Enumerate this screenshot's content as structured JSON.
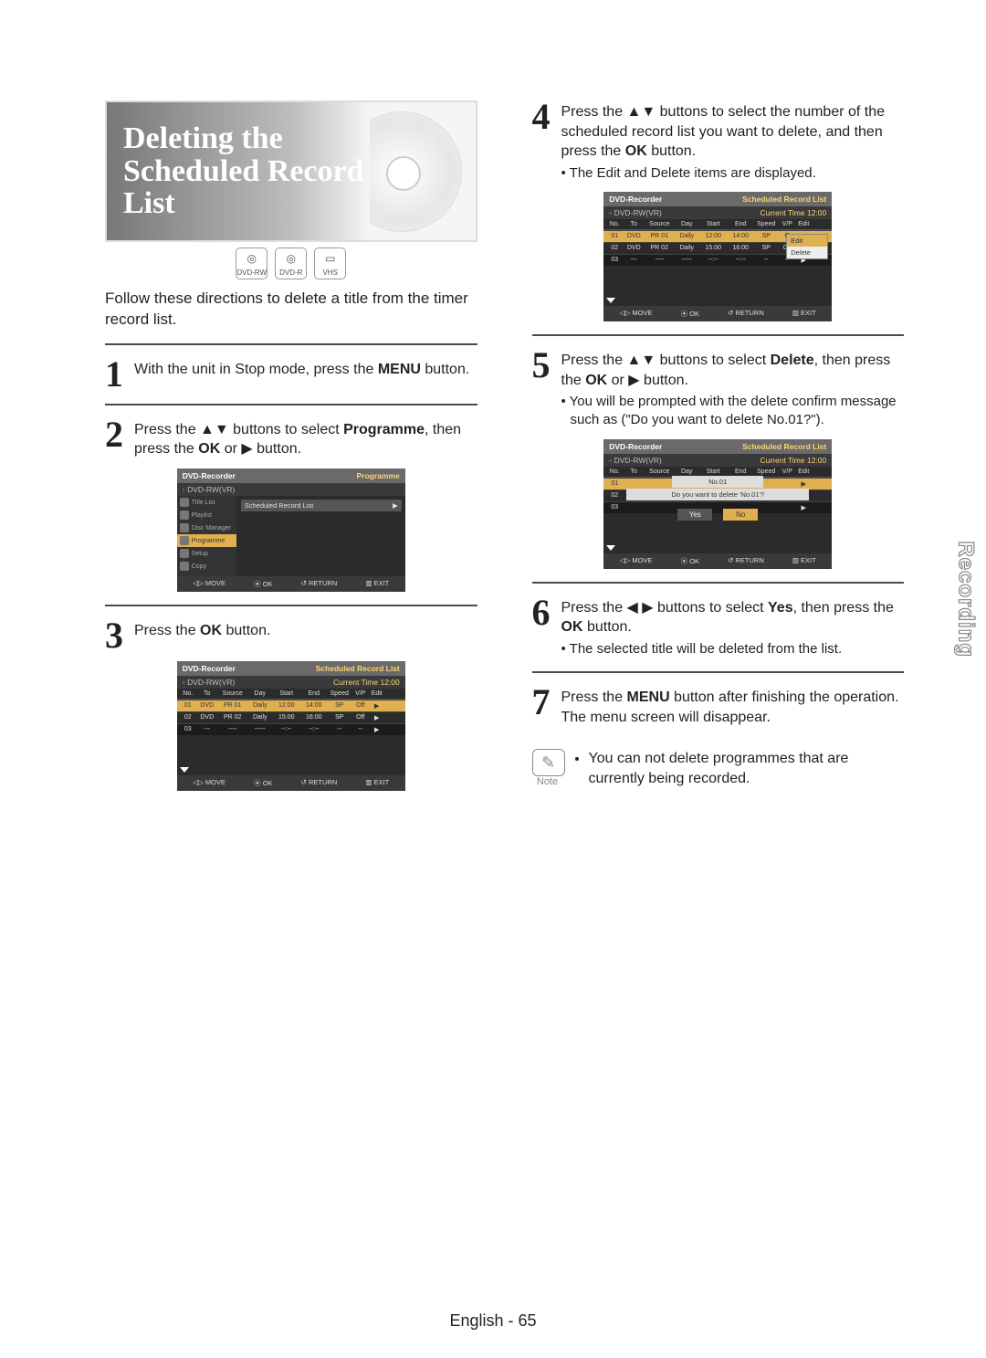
{
  "section_side_tab": "Recording",
  "footer": "English - 65",
  "hero": {
    "title_line1": "Deleting the",
    "title_line2": "Scheduled Record List"
  },
  "media": {
    "dvd_rw": "DVD-RW",
    "dvd_r": "DVD-R",
    "vhs": "VHS"
  },
  "intro": "Follow these directions to delete a title from the timer record list.",
  "step1": {
    "num": "1",
    "text_before": "With the unit in Stop mode, press the ",
    "menu": "MENU",
    "text_after": " button."
  },
  "step2": {
    "num": "2",
    "text_a": "Press the ▲▼ buttons to select ",
    "prog": "Programme",
    "text_b": ", then press the ",
    "ok": "OK",
    "text_c": " or ▶ button."
  },
  "step3": {
    "num": "3",
    "text_a": "Press the ",
    "ok": "OK",
    "text_b": " button."
  },
  "step4": {
    "num": "4",
    "text_a": "Press the ▲▼ buttons to select the number of the scheduled record list you want to delete, and then press the ",
    "ok": "OK",
    "text_b": " button.",
    "bullet": "The Edit and Delete items are displayed."
  },
  "step5": {
    "num": "5",
    "text_a": "Press the ▲▼  buttons to select ",
    "del": "Delete",
    "text_b": ", then press the ",
    "ok": "OK",
    "text_c": " or ▶ button.",
    "bullet": "You will be prompted with the delete confirm message such as (\"Do you want to delete No.01?\")."
  },
  "step6": {
    "num": "6",
    "text_a": "Press the ◀ ▶ buttons to select ",
    "yes": "Yes",
    "text_b": ", then press the ",
    "ok": "OK",
    "text_c": " button.",
    "bullet": "The selected title will be deleted from the list."
  },
  "step7": {
    "num": "7",
    "text_a": "Press the ",
    "menu": "MENU",
    "text_b": " button after finishing the operation. The menu screen will disappear."
  },
  "note": {
    "label": "Note",
    "item": "You can not delete programmes that are currently being recorded."
  },
  "osd_common": {
    "head_left": "DVD-Recorder",
    "head_right_prog": "Programme",
    "head_right_list": "Scheduled Record List",
    "disc": "DVD-RW(VR)",
    "time": "Current Time  12:00",
    "foot_move": "◁▷ MOVE",
    "foot_ok": "⦿ OK",
    "foot_return": "↺ RETURN",
    "foot_exit": "▥ EXIT"
  },
  "osd_menu": {
    "items": [
      "Title List",
      "Playlist",
      "Disc Manager",
      "Programme",
      "Setup",
      "Copy"
    ],
    "right": "Scheduled Record List"
  },
  "osd_table": {
    "headers": [
      "No.",
      "To",
      "Source",
      "Day",
      "Start",
      "End",
      "Speed",
      "V/P",
      "Edit"
    ],
    "rows": [
      {
        "cells": [
          "01",
          "DVD",
          "PR 01",
          "Daily",
          "12:00",
          "14:00",
          "SP",
          "Off",
          "▶"
        ],
        "sel": true
      },
      {
        "cells": [
          "02",
          "DVD",
          "PR 02",
          "Daily",
          "15:00",
          "16:00",
          "SP",
          "Off",
          "▶"
        ],
        "sel": false
      },
      {
        "cells": [
          "03",
          "---",
          "----",
          "-----",
          "--:--",
          "--:--",
          "--",
          "--",
          "▶"
        ],
        "sel": false
      }
    ],
    "rows_popup": [
      {
        "cells": [
          "01",
          "DVD",
          "PR 01",
          "Daily",
          "12:00",
          "14:00",
          "SP",
          "O",
          "▶"
        ],
        "sel": true
      },
      {
        "cells": [
          "02",
          "DVD",
          "PR 02",
          "Daily",
          "15:00",
          "16:00",
          "SP",
          "Off",
          "▶"
        ],
        "sel": false
      },
      {
        "cells": [
          "03",
          "---",
          "----",
          "-----",
          "--:--",
          "--:--",
          "--",
          "--",
          "▶"
        ],
        "sel": false
      }
    ],
    "popup": {
      "edit": "Edit",
      "delete": "Delete"
    }
  },
  "osd_confirm": {
    "label": "No.01",
    "msg": "Do you want to delete 'No.01'?",
    "yes": "Yes",
    "no": "No",
    "rows": [
      {
        "no": "01",
        "sel": true
      },
      {
        "no": "02",
        "sel": false
      },
      {
        "no": "03",
        "sel": false
      }
    ]
  }
}
